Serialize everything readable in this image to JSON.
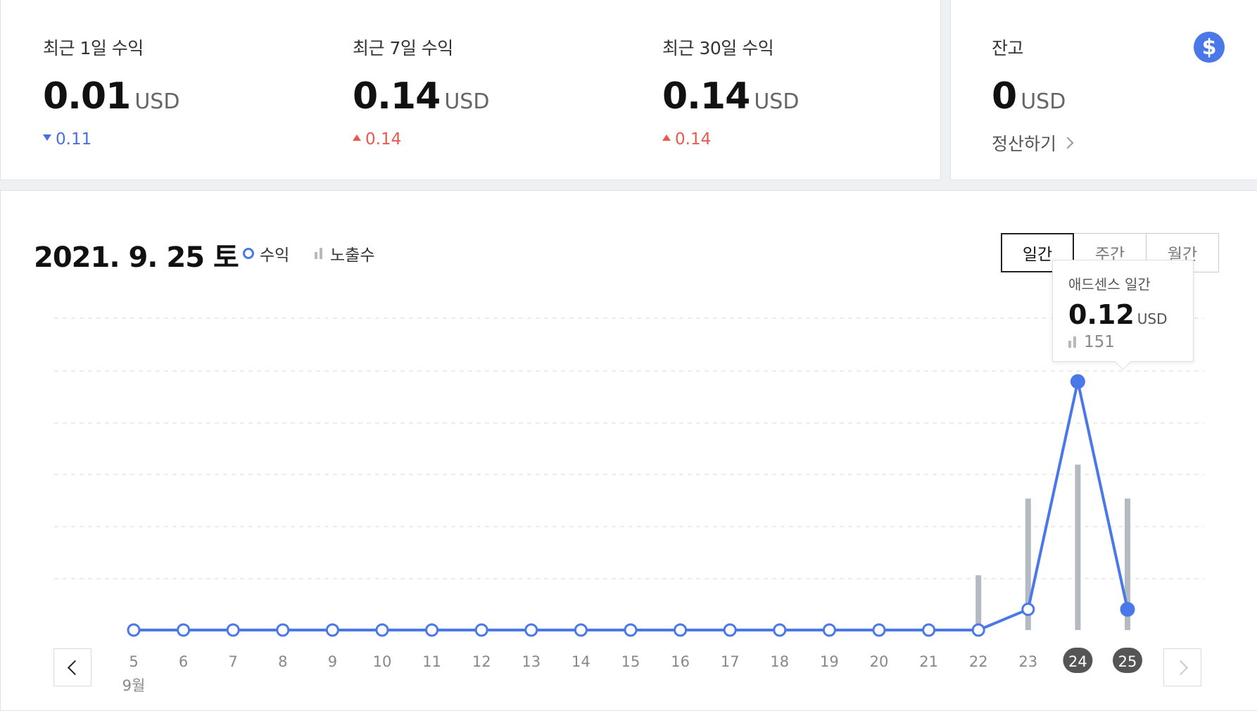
{
  "stats": [
    {
      "label": "최근 1일 수익",
      "value": "0.01",
      "unit": "USD",
      "delta": "0.11",
      "direction": "down"
    },
    {
      "label": "최근 7일 수익",
      "value": "0.14",
      "unit": "USD",
      "delta": "0.14",
      "direction": "up"
    },
    {
      "label": "최근 30일 수익",
      "value": "0.14",
      "unit": "USD",
      "delta": "0.14",
      "direction": "up"
    }
  ],
  "balance": {
    "label": "잔고",
    "value": "0",
    "unit": "USD",
    "settle_label": "정산하기",
    "icon": "dollar-icon",
    "icon_glyph": "$"
  },
  "chart_header": {
    "date": "2021. 9. 25 토",
    "legend_revenue": "수익",
    "legend_impressions": "노출수"
  },
  "period_tabs": [
    "일간",
    "주간",
    "월간"
  ],
  "active_period": "일간",
  "tooltip": {
    "title": "애드센스 일간",
    "value": "0.12",
    "unit": "USD",
    "impressions": "151"
  },
  "month_label": "9월",
  "colors": {
    "accent": "#4a78e8",
    "up": "#e85a4f",
    "down": "#4a6ee0",
    "bars": "#b4bac2",
    "badge": "#555555"
  },
  "chart_data": {
    "type": "line",
    "x": [
      "5",
      "6",
      "7",
      "8",
      "9",
      "10",
      "11",
      "12",
      "13",
      "14",
      "15",
      "16",
      "17",
      "18",
      "19",
      "20",
      "21",
      "22",
      "23",
      "24",
      "25"
    ],
    "series": [
      {
        "name": "수익",
        "values": [
          0,
          0,
          0,
          0,
          0,
          0,
          0,
          0,
          0,
          0,
          0,
          0,
          0,
          0,
          0,
          0,
          0,
          0,
          0.01,
          0.12,
          0.01
        ]
      },
      {
        "name": "노출수",
        "values": [
          0,
          0,
          0,
          0,
          0,
          0,
          0,
          0,
          0,
          0,
          0,
          0,
          0,
          0,
          0,
          0,
          0,
          50,
          120,
          151,
          120
        ]
      }
    ],
    "highlighted_x": [
      "24",
      "25"
    ],
    "grid": true
  }
}
